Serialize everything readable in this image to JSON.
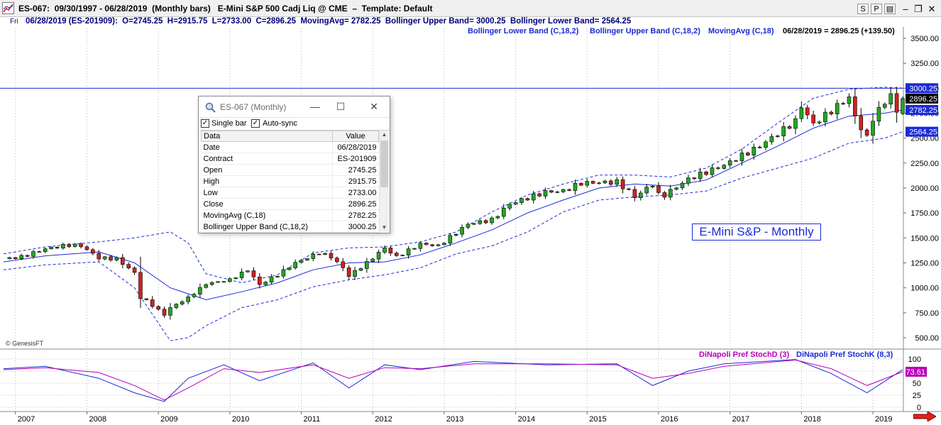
{
  "window": {
    "title": "ES-067:  09/30/1997 - 06/28/2019  (Monthly bars)   E-Mini S&P 500 Cadj Liq @ CME  –  Template: Default",
    "buttons": [
      "S",
      "P",
      "▤",
      "–",
      "❐",
      "✕"
    ]
  },
  "infobar": {
    "day": "Fri",
    "text": "06/28/2019 (ES-201909):  O=2745.25  H=2915.75  L=2733.00  C=2896.25  MovingAvg= 2782.25  Bollinger Upper Band= 3000.25  Bollinger Lower Band= 2564.25"
  },
  "legend": {
    "items": [
      "Bollinger Lower Band (C,18,2)",
      "Bollinger Upper Band (C,18,2)",
      "MovingAvg (C,18)"
    ],
    "close": "06/28/2019 = 2896.25 (+139.50)"
  },
  "price_axis": {
    "ticks": [
      "3500.00",
      "3250.00",
      "3000.00",
      "2750.00",
      "2500.00",
      "2250.00",
      "2000.00",
      "1750.00",
      "1500.00",
      "1250.00",
      "1000.00",
      "750.00",
      "500.00"
    ],
    "markers": [
      {
        "label": "3000.25",
        "value": 3000.25,
        "bg": "#1b2ad6",
        "fg": "#ffffff"
      },
      {
        "label": "2896.25",
        "value": 2896.25,
        "bg": "#000000",
        "fg": "#ffffff"
      },
      {
        "label": "2782.25",
        "value": 2782.25,
        "bg": "#1b2ad6",
        "fg": "#ffffff"
      },
      {
        "label": "2564.25",
        "value": 2564.25,
        "bg": "#1b2ad6",
        "fg": "#ffffff"
      }
    ]
  },
  "stoch_axis": {
    "ticks": [
      "100",
      "75",
      "50",
      "25",
      "0"
    ],
    "marker": {
      "label": "73.61",
      "value": 73.61,
      "bg": "#b800b8",
      "fg": "#ffffff"
    }
  },
  "time_axis": {
    "years": [
      "2007",
      "2008",
      "2009",
      "2010",
      "2011",
      "2012",
      "2013",
      "2014",
      "2015",
      "2016",
      "2017",
      "2018",
      "2019"
    ]
  },
  "stochastic_legend": {
    "d": "DiNapoli Pref StochD (3)",
    "k": "DiNapoli Pref StochK (8,3)"
  },
  "copyright": "© GenesisFT",
  "chart_label": "E-Mini S&P - Monthly",
  "colors": {
    "up": "#22a822",
    "down": "#d42020",
    "ma": "#1b2ad6",
    "band": "#1b2ad6",
    "stoch_d": "#b800b8",
    "stoch_k": "#1b2ad6"
  },
  "dialog": {
    "title": "ES-067 (Monthly)",
    "options": [
      {
        "label": "Single bar",
        "checked": true
      },
      {
        "label": "Auto-sync",
        "checked": true
      }
    ],
    "columns": [
      "Data",
      "Value"
    ],
    "rows": [
      [
        "Date",
        "06/28/2019"
      ],
      [
        "Contract",
        "ES-201909"
      ],
      [
        "Open",
        "2745.25"
      ],
      [
        "High",
        "2915.75"
      ],
      [
        "Low",
        "2733.00"
      ],
      [
        "Close",
        "2896.25"
      ],
      [
        "MovingAvg (C,18)",
        "2782.25"
      ],
      [
        "Bollinger Upper Band (C,18,2)",
        "3000.25"
      ]
    ]
  },
  "chart_data": {
    "type": "candlestick",
    "title": "E-Mini S&P - Monthly",
    "x_range": [
      "2006-11",
      "2019-06"
    ],
    "ylim": [
      400,
      3550
    ],
    "y_ticks": [
      500,
      750,
      1000,
      1250,
      1500,
      1750,
      2000,
      2250,
      2500,
      2750,
      3000,
      3250,
      3500
    ],
    "reference_line": 3000.25,
    "last_bar": {
      "date": "06/28/2019",
      "open": 2745.25,
      "high": 2915.75,
      "low": 2733.0,
      "close": 2896.25
    },
    "close_path": [
      [
        "2006-11",
        1290
      ],
      [
        "2007-02",
        1310
      ],
      [
        "2007-06",
        1390
      ],
      [
        "2007-10",
        1430
      ],
      [
        "2007-12",
        1420
      ],
      [
        "2008-03",
        1300
      ],
      [
        "2008-06",
        1290
      ],
      [
        "2008-09",
        1150
      ],
      [
        "2008-10",
        900
      ],
      [
        "2008-11",
        870
      ],
      [
        "2009-02",
        730
      ],
      [
        "2009-03",
        800
      ],
      [
        "2009-06",
        900
      ],
      [
        "2009-09",
        1040
      ],
      [
        "2010-01",
        1080
      ],
      [
        "2010-04",
        1180
      ],
      [
        "2010-06",
        1030
      ],
      [
        "2010-09",
        1130
      ],
      [
        "2010-12",
        1250
      ],
      [
        "2011-04",
        1350
      ],
      [
        "2011-06",
        1310
      ],
      [
        "2011-08",
        1200
      ],
      [
        "2011-09",
        1120
      ],
      [
        "2011-12",
        1250
      ],
      [
        "2012-03",
        1400
      ],
      [
        "2012-05",
        1310
      ],
      [
        "2012-09",
        1440
      ],
      [
        "2012-12",
        1420
      ],
      [
        "2013-05",
        1640
      ],
      [
        "2013-09",
        1680
      ],
      [
        "2013-12",
        1840
      ],
      [
        "2014-06",
        1960
      ],
      [
        "2014-09",
        1970
      ],
      [
        "2014-12",
        2050
      ],
      [
        "2015-06",
        2060
      ],
      [
        "2015-08",
        1970
      ],
      [
        "2015-09",
        1910
      ],
      [
        "2015-12",
        2040
      ],
      [
        "2016-01",
        1930
      ],
      [
        "2016-02",
        1930
      ],
      [
        "2016-06",
        2090
      ],
      [
        "2016-12",
        2230
      ],
      [
        "2017-06",
        2420
      ],
      [
        "2017-12",
        2670
      ],
      [
        "2018-01",
        2820
      ],
      [
        "2018-03",
        2640
      ],
      [
        "2018-09",
        2910
      ],
      [
        "2018-10",
        2710
      ],
      [
        "2018-12",
        2500
      ],
      [
        "2019-01",
        2700
      ],
      [
        "2019-04",
        2940
      ],
      [
        "2019-05",
        2750
      ],
      [
        "2019-06",
        2896.25
      ]
    ],
    "moving_average": {
      "name": "MovingAvg (C,18)",
      "path": [
        [
          "2006-11",
          1260
        ],
        [
          "2007-06",
          1320
        ],
        [
          "2008-03",
          1360
        ],
        [
          "2008-09",
          1250
        ],
        [
          "2009-03",
          1000
        ],
        [
          "2009-09",
          880
        ],
        [
          "2010-03",
          960
        ],
        [
          "2010-09",
          1050
        ],
        [
          "2011-03",
          1180
        ],
        [
          "2011-09",
          1250
        ],
        [
          "2012-03",
          1260
        ],
        [
          "2012-09",
          1330
        ],
        [
          "2013-03",
          1450
        ],
        [
          "2013-09",
          1580
        ],
        [
          "2014-03",
          1750
        ],
        [
          "2014-09",
          1880
        ],
        [
          "2015-03",
          2000
        ],
        [
          "2015-09",
          2040
        ],
        [
          "2016-03",
          2020
        ],
        [
          "2016-09",
          2080
        ],
        [
          "2017-03",
          2250
        ],
        [
          "2017-09",
          2420
        ],
        [
          "2018-03",
          2600
        ],
        [
          "2018-09",
          2720
        ],
        [
          "2019-03",
          2750
        ],
        [
          "2019-06",
          2782.25
        ]
      ]
    },
    "bollinger_upper": {
      "name": "Bollinger Upper Band (C,18,2)",
      "path": [
        [
          "2006-11",
          1340
        ],
        [
          "2007-06",
          1410
        ],
        [
          "2008-03",
          1460
        ],
        [
          "2008-09",
          1500
        ],
        [
          "2009-03",
          1560
        ],
        [
          "2009-06",
          1450
        ],
        [
          "2009-09",
          1140
        ],
        [
          "2010-03",
          1050
        ],
        [
          "2010-09",
          1130
        ],
        [
          "2011-03",
          1350
        ],
        [
          "2011-09",
          1400
        ],
        [
          "2012-03",
          1410
        ],
        [
          "2012-09",
          1460
        ],
        [
          "2013-03",
          1560
        ],
        [
          "2013-09",
          1760
        ],
        [
          "2014-03",
          1930
        ],
        [
          "2014-09",
          2040
        ],
        [
          "2015-03",
          2130
        ],
        [
          "2015-09",
          2130
        ],
        [
          "2016-03",
          2110
        ],
        [
          "2016-09",
          2200
        ],
        [
          "2017-03",
          2390
        ],
        [
          "2017-09",
          2650
        ],
        [
          "2018-03",
          2900
        ],
        [
          "2018-09",
          2990
        ],
        [
          "2019-03",
          3010
        ],
        [
          "2019-06",
          3000.25
        ]
      ]
    },
    "bollinger_lower": {
      "name": "Bollinger Lower Band (C,18,2)",
      "path": [
        [
          "2006-11",
          1180
        ],
        [
          "2007-06",
          1230
        ],
        [
          "2008-03",
          1260
        ],
        [
          "2008-09",
          1000
        ],
        [
          "2009-03",
          470
        ],
        [
          "2009-06",
          500
        ],
        [
          "2009-09",
          620
        ],
        [
          "2010-03",
          800
        ],
        [
          "2010-09",
          880
        ],
        [
          "2011-03",
          1010
        ],
        [
          "2011-09",
          1080
        ],
        [
          "2012-03",
          1130
        ],
        [
          "2012-09",
          1200
        ],
        [
          "2013-03",
          1340
        ],
        [
          "2013-09",
          1420
        ],
        [
          "2014-03",
          1560
        ],
        [
          "2014-09",
          1760
        ],
        [
          "2015-03",
          1880
        ],
        [
          "2015-09",
          1910
        ],
        [
          "2016-03",
          1930
        ],
        [
          "2016-09",
          1970
        ],
        [
          "2017-03",
          2100
        ],
        [
          "2017-09",
          2200
        ],
        [
          "2018-03",
          2300
        ],
        [
          "2018-09",
          2450
        ],
        [
          "2019-03",
          2500
        ],
        [
          "2019-06",
          2564.25
        ]
      ]
    },
    "stochastic": {
      "ylim": [
        0,
        100
      ],
      "stoch_d": {
        "name": "DiNapoli Pref StochD (3)",
        "path": [
          [
            "2006-11",
            78
          ],
          [
            "2007-06",
            82
          ],
          [
            "2008-03",
            72
          ],
          [
            "2008-09",
            45
          ],
          [
            "2009-02",
            15
          ],
          [
            "2009-06",
            40
          ],
          [
            "2009-12",
            80
          ],
          [
            "2010-06",
            72
          ],
          [
            "2011-03",
            88
          ],
          [
            "2011-09",
            60
          ],
          [
            "2012-03",
            82
          ],
          [
            "2012-09",
            80
          ],
          [
            "2013-06",
            90
          ],
          [
            "2014-06",
            90
          ],
          [
            "2015-06",
            88
          ],
          [
            "2015-12",
            60
          ],
          [
            "2016-06",
            70
          ],
          [
            "2016-12",
            85
          ],
          [
            "2017-12",
            98
          ],
          [
            "2018-06",
            80
          ],
          [
            "2018-12",
            45
          ],
          [
            "2019-06",
            73.61
          ]
        ]
      },
      "stoch_k": {
        "name": "DiNapoli Pref StochK (8,3)",
        "path": [
          [
            "2006-11",
            80
          ],
          [
            "2007-06",
            85
          ],
          [
            "2008-03",
            60
          ],
          [
            "2008-09",
            30
          ],
          [
            "2009-02",
            12
          ],
          [
            "2009-06",
            60
          ],
          [
            "2009-12",
            88
          ],
          [
            "2010-06",
            55
          ],
          [
            "2011-03",
            92
          ],
          [
            "2011-09",
            40
          ],
          [
            "2012-03",
            88
          ],
          [
            "2012-09",
            78
          ],
          [
            "2013-06",
            95
          ],
          [
            "2014-06",
            88
          ],
          [
            "2015-06",
            90
          ],
          [
            "2015-12",
            45
          ],
          [
            "2016-06",
            75
          ],
          [
            "2016-12",
            90
          ],
          [
            "2017-12",
            99
          ],
          [
            "2018-06",
            70
          ],
          [
            "2018-12",
            30
          ],
          [
            "2019-06",
            78
          ]
        ]
      }
    }
  }
}
